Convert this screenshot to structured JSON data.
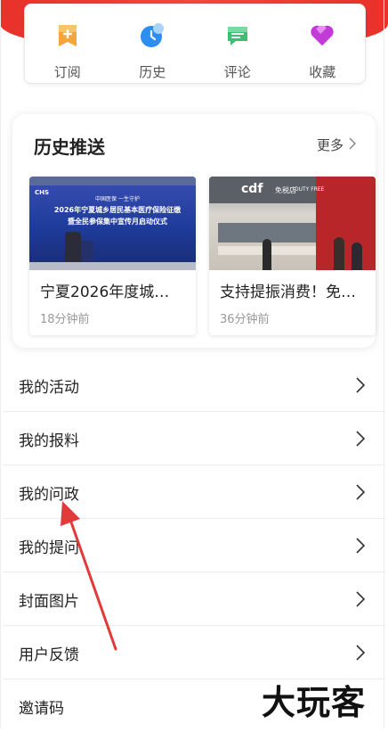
{
  "quick_entries": [
    {
      "label": "订阅",
      "icon": "subscribe-icon"
    },
    {
      "label": "历史",
      "icon": "history-icon"
    },
    {
      "label": "评论",
      "icon": "comment-icon"
    },
    {
      "label": "收藏",
      "icon": "favorite-icon"
    }
  ],
  "history": {
    "title": "历史推送",
    "more": "更多",
    "items": [
      {
        "headline": "宁夏2026年度城…",
        "time": "18分钟前",
        "thumb_lines": [
          "中国医保  一生守护",
          "2026年宁夏城乡居民基本医疗保险征缴",
          "暨全民参保集中宣传月启动仪式"
        ],
        "thumb_logo": "CHS"
      },
      {
        "headline": "支持提振消费！免…",
        "time": "36分钟前",
        "thumb_sign": "cdf",
        "thumb_sign2": "免税店",
        "thumb_sign3": "DUTY FREE"
      }
    ]
  },
  "menu": [
    {
      "label": "我的活动"
    },
    {
      "label": "我的报料"
    },
    {
      "label": "我的问政"
    },
    {
      "label": "我的提问"
    },
    {
      "label": "封面图片"
    },
    {
      "label": "用户反馈"
    },
    {
      "label": "邀请码"
    }
  ],
  "watermark": "大玩客",
  "colors": {
    "brand": "#e8312a",
    "annotation": "#e03a3a"
  }
}
